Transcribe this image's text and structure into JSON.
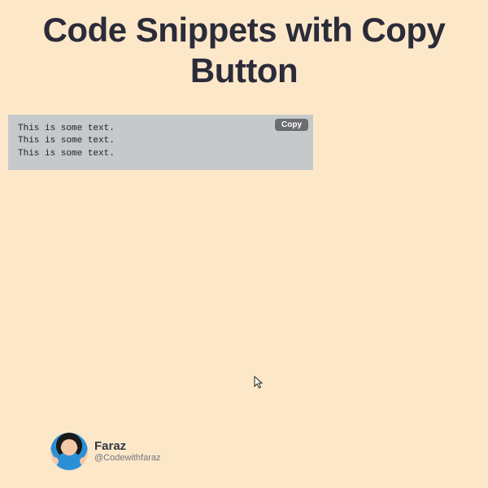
{
  "title": "Code Snippets with Copy Button",
  "snippet": {
    "lines": [
      "This is some text.",
      "This is some text.",
      "This is some text."
    ],
    "copy_label": "Copy"
  },
  "profile": {
    "name": "Faraz",
    "handle": "@Codewithfaraz"
  }
}
